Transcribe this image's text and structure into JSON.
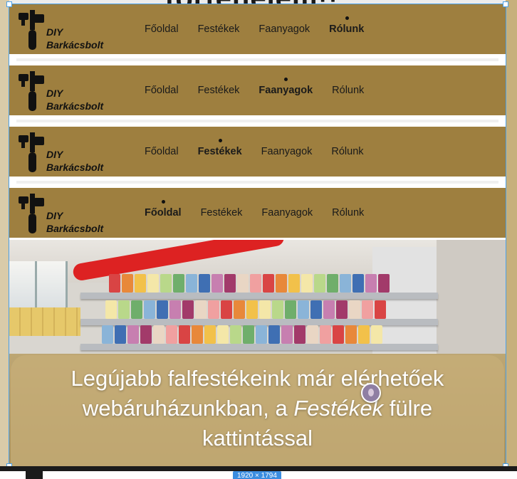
{
  "canvas": {
    "heading_peek": "történelem!!",
    "frame_size_label": "1920 × 1794"
  },
  "brand": {
    "line1": "DIY",
    "line2": "Barkácsbolt",
    "icon": "paint-roller-icon"
  },
  "nav_items": [
    "Főoldal",
    "Festékek",
    "Faanyagok",
    "Rólunk"
  ],
  "navbars": [
    {
      "active": 3
    },
    {
      "active": 2
    },
    {
      "active": 1
    },
    {
      "active": 0
    }
  ],
  "hero": {
    "caption_before": "Legújabb falfestékeink már elérhetőek webáruházunkban, a ",
    "caption_emph": "Festékek",
    "caption_after": " fülre kattintással"
  },
  "colors": {
    "navbar": "#9e7f3f",
    "selection": "#4aa0e8"
  }
}
